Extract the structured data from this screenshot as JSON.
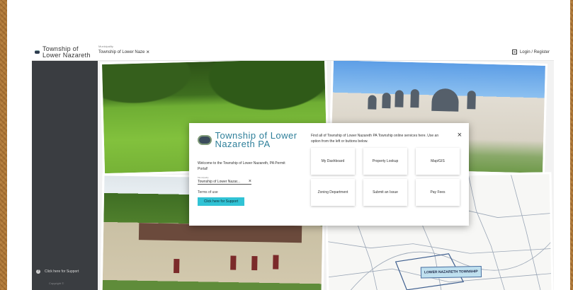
{
  "header": {
    "brand_name": "Township of Lower Nazareth",
    "municipality_label": "Municipality",
    "municipality_value": "Township of Lower Naze",
    "clear_icon": "close-icon",
    "login_label": "Login / Register",
    "login_icon": "login-icon"
  },
  "sidebar": {
    "support_label": "Click here for Support",
    "support_icon": "help-icon",
    "copyright": "Copyright ©"
  },
  "collage": {
    "map_label": "LOWER NAZARETH TOWNSHIP"
  },
  "modal": {
    "title": "Township of Lower Nazareth PA",
    "welcome": "Welcome to the Township of Lower Nazareth, PA Permit Portal!",
    "municipality_label": "Municipality",
    "municipality_value": "Township of Lower Nazar...",
    "terms": "Terms of use",
    "support_button": "Click here for Support",
    "intro": "Find all of Township of Lower Nazareth PA Township online services here. Use an option from the left or buttons below.",
    "tiles": [
      "My Dashboard",
      "Property Lookup",
      "Map/GIS",
      "Zoning Department",
      "Submit an Issue",
      "Pay Fees"
    ]
  },
  "colors": {
    "accent": "#31c3d5",
    "title": "#2e7f9a",
    "sidebar": "#3a3d41"
  }
}
